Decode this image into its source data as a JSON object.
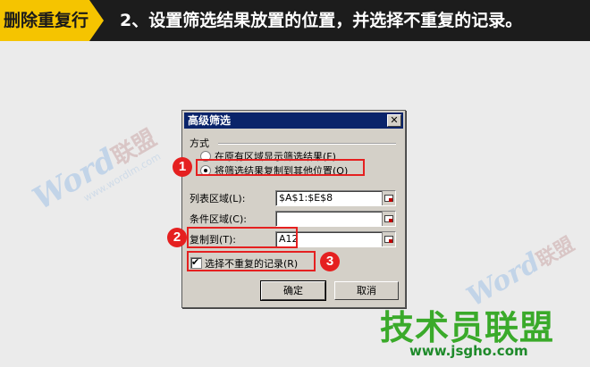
{
  "banner": {
    "tag": "删除重复行",
    "title": "2、设置筛选结果放置的位置，并选择不重复的记录。"
  },
  "watermark": {
    "word": "Word",
    "suffix": "联盟",
    "url": "www.wordlm.com"
  },
  "brand": {
    "name": "技术员联盟",
    "url": "www.jsgho.com"
  },
  "dialog": {
    "title": "高级筛选",
    "close_label": "✕",
    "method_label": "方式",
    "radio_options": [
      {
        "label": "在原有区域显示筛选结果(F)",
        "checked": false
      },
      {
        "label": "将筛选结果复制到其他位置(O)",
        "checked": true
      }
    ],
    "fields": [
      {
        "label": "列表区域(L):",
        "value": "$A$1:$E$8"
      },
      {
        "label": "条件区域(C):",
        "value": ""
      },
      {
        "label": "复制到(T):",
        "value": "A12"
      }
    ],
    "checkbox": {
      "label": "选择不重复的记录(R)",
      "checked": true
    },
    "ok_label": "确定",
    "cancel_label": "取消"
  },
  "annotations": {
    "step1": "1",
    "step2": "2",
    "step3": "3"
  },
  "colors": {
    "banner_bg": "#1c1c1c",
    "tag_bg": "#f5c400",
    "highlight": "#e52020",
    "titlebar": "#0a246a",
    "brand": "#3aaa2a"
  }
}
